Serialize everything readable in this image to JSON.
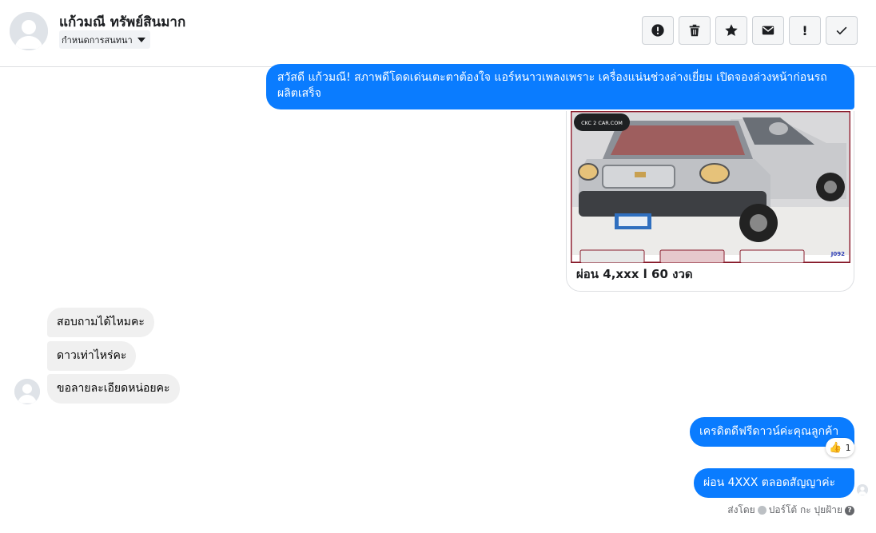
{
  "header": {
    "contact_name": "แก้วมณี ทรัพย์สินมาก",
    "stage_label": "กำหนดการสนทนา",
    "actions": [
      "alert-circle-icon",
      "trash-icon",
      "star-icon",
      "envelope-icon",
      "exclamation-icon",
      "checkmark-icon"
    ],
    "exclamation_text": "!"
  },
  "messages": {
    "greeting": "สวัสดี แก้วมณี! สภาพดีโดดเด่นเตะตาต้องใจ แอร์หนาวเพลงเพราะ เครื่องแน่นช่วงล่างเยี่ยม เปิดจองล่วงหน้าก่อนรถผลิตเสร็จ",
    "card": {
      "image_watermark": "CKC 2 CAR.COM",
      "image_code": "J092",
      "caption": "ผ่อน 4,xxx l 60 งวด"
    },
    "incoming": [
      "สอบถามได้ไหมคะ",
      "ดาวเท่าไหร่คะ",
      "ขอลายละเอียดหน่อยคะ"
    ],
    "reply_1": "เครดิตดีฟรีดาวน์ค่ะคุณลูกค้า",
    "reaction": {
      "emoji": "👍",
      "count": "1"
    },
    "reply_2": "ผ่อน 4XXX ตลอดสัญญาค่ะ"
  },
  "footer": {
    "sent_by_label": "ส่งโดย",
    "sender_name": "ปอร์โต้ กะ ปุยฝ้าย"
  },
  "colors": {
    "outgoing_bubble": "#0a7cff",
    "incoming_bubble": "#f0f0f0"
  }
}
